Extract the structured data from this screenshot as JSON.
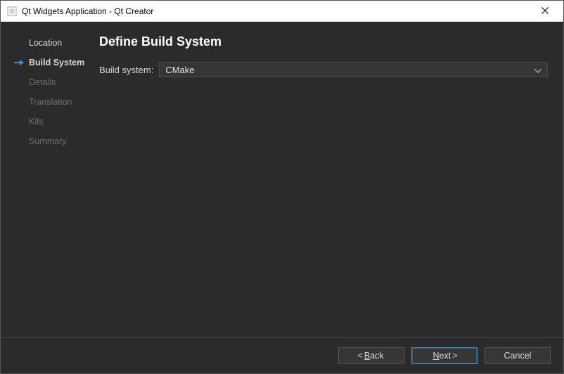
{
  "window": {
    "title": "Qt Widgets Application - Qt Creator",
    "close_label": "Close"
  },
  "sidebar": {
    "items": [
      {
        "label": "Location",
        "state": "completed"
      },
      {
        "label": "Build System",
        "state": "current"
      },
      {
        "label": "Details",
        "state": "pending"
      },
      {
        "label": "Translation",
        "state": "pending"
      },
      {
        "label": "Kits",
        "state": "pending"
      },
      {
        "label": "Summary",
        "state": "pending"
      }
    ]
  },
  "page": {
    "title": "Define Build System",
    "build_system_label": "Build system:",
    "build_system_value": "CMake"
  },
  "buttons": {
    "back": {
      "prefix": "< ",
      "mnemonic": "B",
      "rest": "ack",
      "suffix": ""
    },
    "next": {
      "prefix": "",
      "mnemonic": "N",
      "rest": "ext",
      "suffix": " >"
    },
    "cancel": {
      "prefix": "",
      "mnemonic": "",
      "rest": "Cancel",
      "suffix": ""
    }
  }
}
